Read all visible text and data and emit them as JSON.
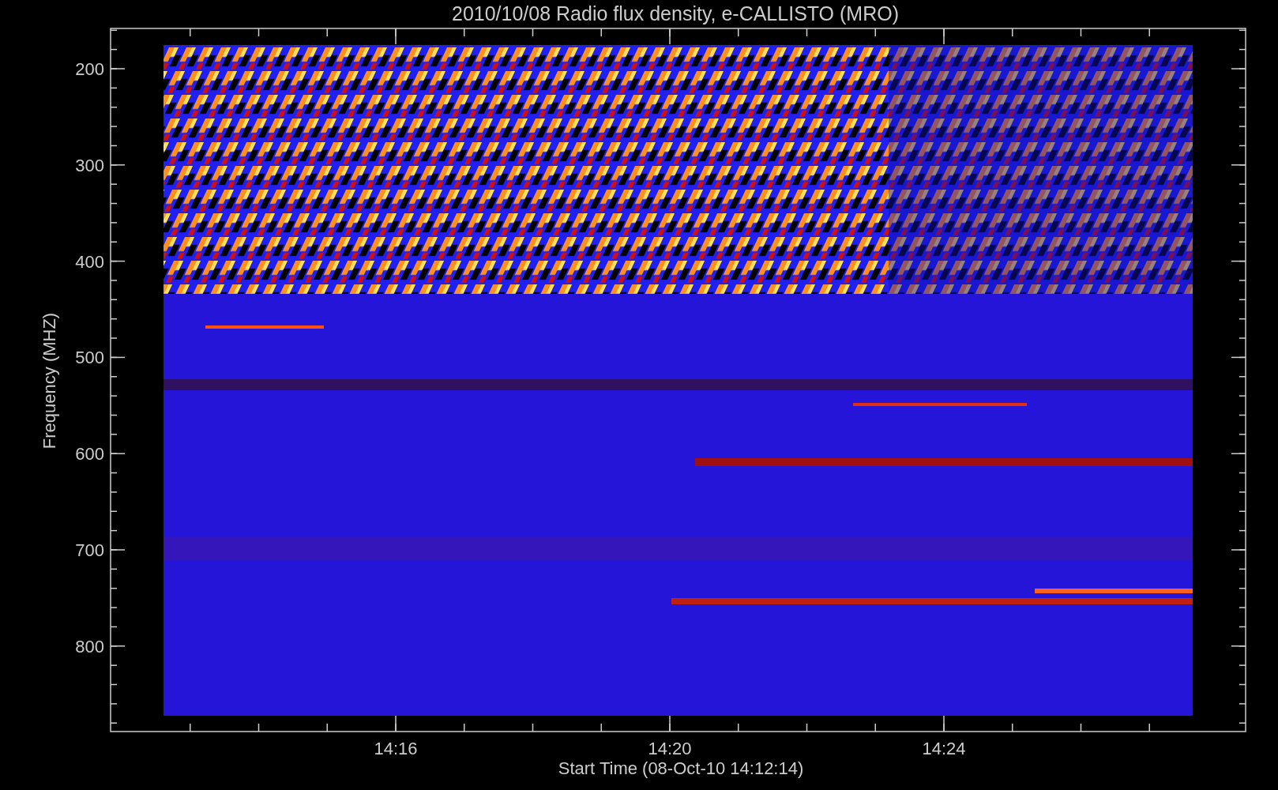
{
  "title": "2010/10/08  Radio flux density, e-CALLISTO (MRO)",
  "plot": {
    "ylabel": "Frequency (MHZ)",
    "xlabel": "Start Time (08-Oct-10 14:12:14)",
    "yticks": [
      "200",
      "300",
      "400",
      "500",
      "600",
      "700",
      "800"
    ],
    "xticks": [
      "14:16",
      "14:20",
      "14:24"
    ]
  }
}
